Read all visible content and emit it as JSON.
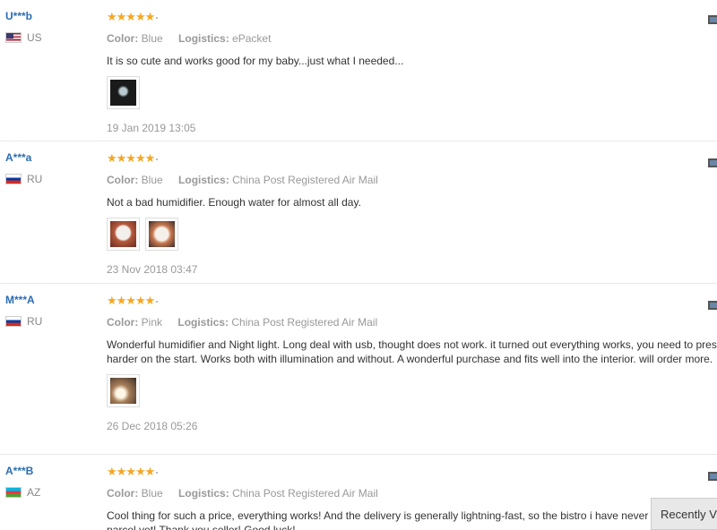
{
  "reviews": [
    {
      "user": "U***b",
      "country": "US",
      "stars": "★★★★★",
      "color_label": "Color:",
      "color_value": "Blue",
      "logistics_label": "Logistics:",
      "logistics_value": "ePacket",
      "content": "It is so cute and works good for my baby...just what I needed...",
      "date": "19 Jan 2019 13:05"
    },
    {
      "user": "A***a",
      "country": "RU",
      "stars": "★★★★★",
      "color_label": "Color:",
      "color_value": "Blue",
      "logistics_label": "Logistics:",
      "logistics_value": "China Post Registered Air Mail",
      "content": "Not a bad humidifier. Enough water for almost all day.",
      "date": "23 Nov 2018 03:47"
    },
    {
      "user": "M***A",
      "country": "RU",
      "stars": "★★★★★",
      "color_label": "Color:",
      "color_value": "Pink",
      "logistics_label": "Logistics:",
      "logistics_value": "China Post Registered Air Mail",
      "content": "Wonderful humidifier and Night light. Long deal with usb, thought does not work. it turned out everything works, you need to press harder on the start. Works both with illumination and without. A wonderful purchase and fits well into the interior. will order more.",
      "date": "26 Dec 2018 05:26"
    },
    {
      "user": "A***B",
      "country": "AZ",
      "stars": "★★★★★",
      "color_label": "Color:",
      "color_value": "Blue",
      "logistics_label": "Logistics:",
      "logistics_value": "China Post Registered Air Mail",
      "content": "Cool thing for such a price, everything works! And the delivery is generally lightning-fast, so the bistro i have never received a parcel yet! Thank you seller! Good luck!",
      "date": ""
    }
  ],
  "recently_viewed_label": "Recently Viewed"
}
